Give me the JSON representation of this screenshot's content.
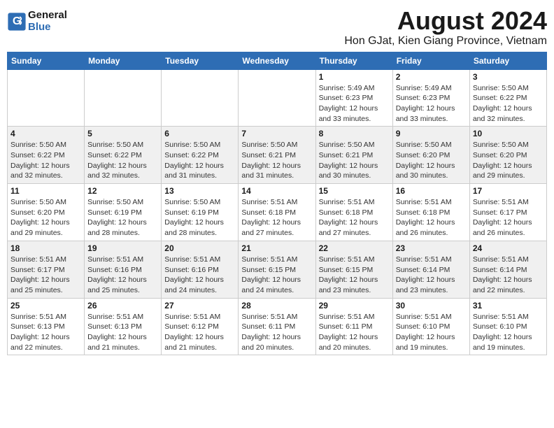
{
  "header": {
    "logo_line1": "General",
    "logo_line2": "Blue",
    "month": "August 2024",
    "location": "Hon GJat, Kien Giang Province, Vietnam"
  },
  "days_of_week": [
    "Sunday",
    "Monday",
    "Tuesday",
    "Wednesday",
    "Thursday",
    "Friday",
    "Saturday"
  ],
  "weeks": [
    [
      {
        "day": "",
        "info": ""
      },
      {
        "day": "",
        "info": ""
      },
      {
        "day": "",
        "info": ""
      },
      {
        "day": "",
        "info": ""
      },
      {
        "day": "1",
        "info": "Sunrise: 5:49 AM\nSunset: 6:23 PM\nDaylight: 12 hours\nand 33 minutes."
      },
      {
        "day": "2",
        "info": "Sunrise: 5:49 AM\nSunset: 6:23 PM\nDaylight: 12 hours\nand 33 minutes."
      },
      {
        "day": "3",
        "info": "Sunrise: 5:50 AM\nSunset: 6:22 PM\nDaylight: 12 hours\nand 32 minutes."
      }
    ],
    [
      {
        "day": "4",
        "info": "Sunrise: 5:50 AM\nSunset: 6:22 PM\nDaylight: 12 hours\nand 32 minutes."
      },
      {
        "day": "5",
        "info": "Sunrise: 5:50 AM\nSunset: 6:22 PM\nDaylight: 12 hours\nand 32 minutes."
      },
      {
        "day": "6",
        "info": "Sunrise: 5:50 AM\nSunset: 6:22 PM\nDaylight: 12 hours\nand 31 minutes."
      },
      {
        "day": "7",
        "info": "Sunrise: 5:50 AM\nSunset: 6:21 PM\nDaylight: 12 hours\nand 31 minutes."
      },
      {
        "day": "8",
        "info": "Sunrise: 5:50 AM\nSunset: 6:21 PM\nDaylight: 12 hours\nand 30 minutes."
      },
      {
        "day": "9",
        "info": "Sunrise: 5:50 AM\nSunset: 6:20 PM\nDaylight: 12 hours\nand 30 minutes."
      },
      {
        "day": "10",
        "info": "Sunrise: 5:50 AM\nSunset: 6:20 PM\nDaylight: 12 hours\nand 29 minutes."
      }
    ],
    [
      {
        "day": "11",
        "info": "Sunrise: 5:50 AM\nSunset: 6:20 PM\nDaylight: 12 hours\nand 29 minutes."
      },
      {
        "day": "12",
        "info": "Sunrise: 5:50 AM\nSunset: 6:19 PM\nDaylight: 12 hours\nand 28 minutes."
      },
      {
        "day": "13",
        "info": "Sunrise: 5:50 AM\nSunset: 6:19 PM\nDaylight: 12 hours\nand 28 minutes."
      },
      {
        "day": "14",
        "info": "Sunrise: 5:51 AM\nSunset: 6:18 PM\nDaylight: 12 hours\nand 27 minutes."
      },
      {
        "day": "15",
        "info": "Sunrise: 5:51 AM\nSunset: 6:18 PM\nDaylight: 12 hours\nand 27 minutes."
      },
      {
        "day": "16",
        "info": "Sunrise: 5:51 AM\nSunset: 6:18 PM\nDaylight: 12 hours\nand 26 minutes."
      },
      {
        "day": "17",
        "info": "Sunrise: 5:51 AM\nSunset: 6:17 PM\nDaylight: 12 hours\nand 26 minutes."
      }
    ],
    [
      {
        "day": "18",
        "info": "Sunrise: 5:51 AM\nSunset: 6:17 PM\nDaylight: 12 hours\nand 25 minutes."
      },
      {
        "day": "19",
        "info": "Sunrise: 5:51 AM\nSunset: 6:16 PM\nDaylight: 12 hours\nand 25 minutes."
      },
      {
        "day": "20",
        "info": "Sunrise: 5:51 AM\nSunset: 6:16 PM\nDaylight: 12 hours\nand 24 minutes."
      },
      {
        "day": "21",
        "info": "Sunrise: 5:51 AM\nSunset: 6:15 PM\nDaylight: 12 hours\nand 24 minutes."
      },
      {
        "day": "22",
        "info": "Sunrise: 5:51 AM\nSunset: 6:15 PM\nDaylight: 12 hours\nand 23 minutes."
      },
      {
        "day": "23",
        "info": "Sunrise: 5:51 AM\nSunset: 6:14 PM\nDaylight: 12 hours\nand 23 minutes."
      },
      {
        "day": "24",
        "info": "Sunrise: 5:51 AM\nSunset: 6:14 PM\nDaylight: 12 hours\nand 22 minutes."
      }
    ],
    [
      {
        "day": "25",
        "info": "Sunrise: 5:51 AM\nSunset: 6:13 PM\nDaylight: 12 hours\nand 22 minutes."
      },
      {
        "day": "26",
        "info": "Sunrise: 5:51 AM\nSunset: 6:13 PM\nDaylight: 12 hours\nand 21 minutes."
      },
      {
        "day": "27",
        "info": "Sunrise: 5:51 AM\nSunset: 6:12 PM\nDaylight: 12 hours\nand 21 minutes."
      },
      {
        "day": "28",
        "info": "Sunrise: 5:51 AM\nSunset: 6:11 PM\nDaylight: 12 hours\nand 20 minutes."
      },
      {
        "day": "29",
        "info": "Sunrise: 5:51 AM\nSunset: 6:11 PM\nDaylight: 12 hours\nand 20 minutes."
      },
      {
        "day": "30",
        "info": "Sunrise: 5:51 AM\nSunset: 6:10 PM\nDaylight: 12 hours\nand 19 minutes."
      },
      {
        "day": "31",
        "info": "Sunrise: 5:51 AM\nSunset: 6:10 PM\nDaylight: 12 hours\nand 19 minutes."
      }
    ]
  ]
}
